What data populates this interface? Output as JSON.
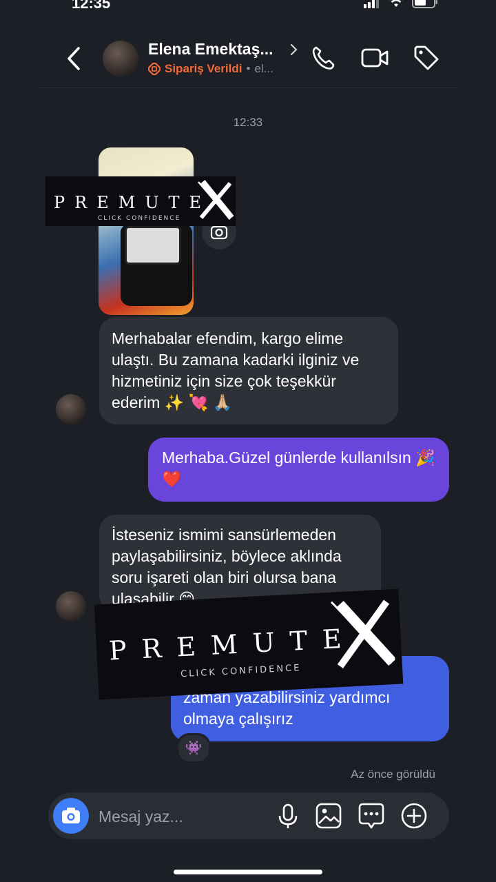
{
  "status_bar": {
    "time": "12:35"
  },
  "header": {
    "contact_name": "Elena Emektaş...",
    "order_status": "Sipariş Verildi",
    "separator": "•",
    "sub_extra": "el..."
  },
  "conversation": {
    "timestamp": "12:33",
    "messages": [
      {
        "sender": "contact",
        "text": "Merhabalar efendim, kargo elime ulaştı. Bu zamana kadarki ilginiz ve hizmetiniz için size çok teşekkür ederim ✨ 💘 🙏🏼"
      },
      {
        "sender": "me",
        "text": "Merhaba.Güzel günlerde kullanılsın 🎉❤️"
      },
      {
        "sender": "contact",
        "text": "İsteseniz ismimi sansürlemeden paylaşabilirsiniz, böylece aklında soru işareti olan biri olursa bana ulaşabilir 😊"
      },
      {
        "sender": "me",
        "text": "... ederiz efendim 😊 Dilediğiniz zaman yazabilirsiniz yardımcı olmaya çalışırız"
      }
    ],
    "reaction": "👾",
    "seen_status": "Az önce görüldü"
  },
  "watermark": {
    "brand": "PREMUTE",
    "brand_x": "X",
    "tagline": "CLICK CONFIDENCE"
  },
  "composer": {
    "placeholder": "Mesaj yaz..."
  }
}
